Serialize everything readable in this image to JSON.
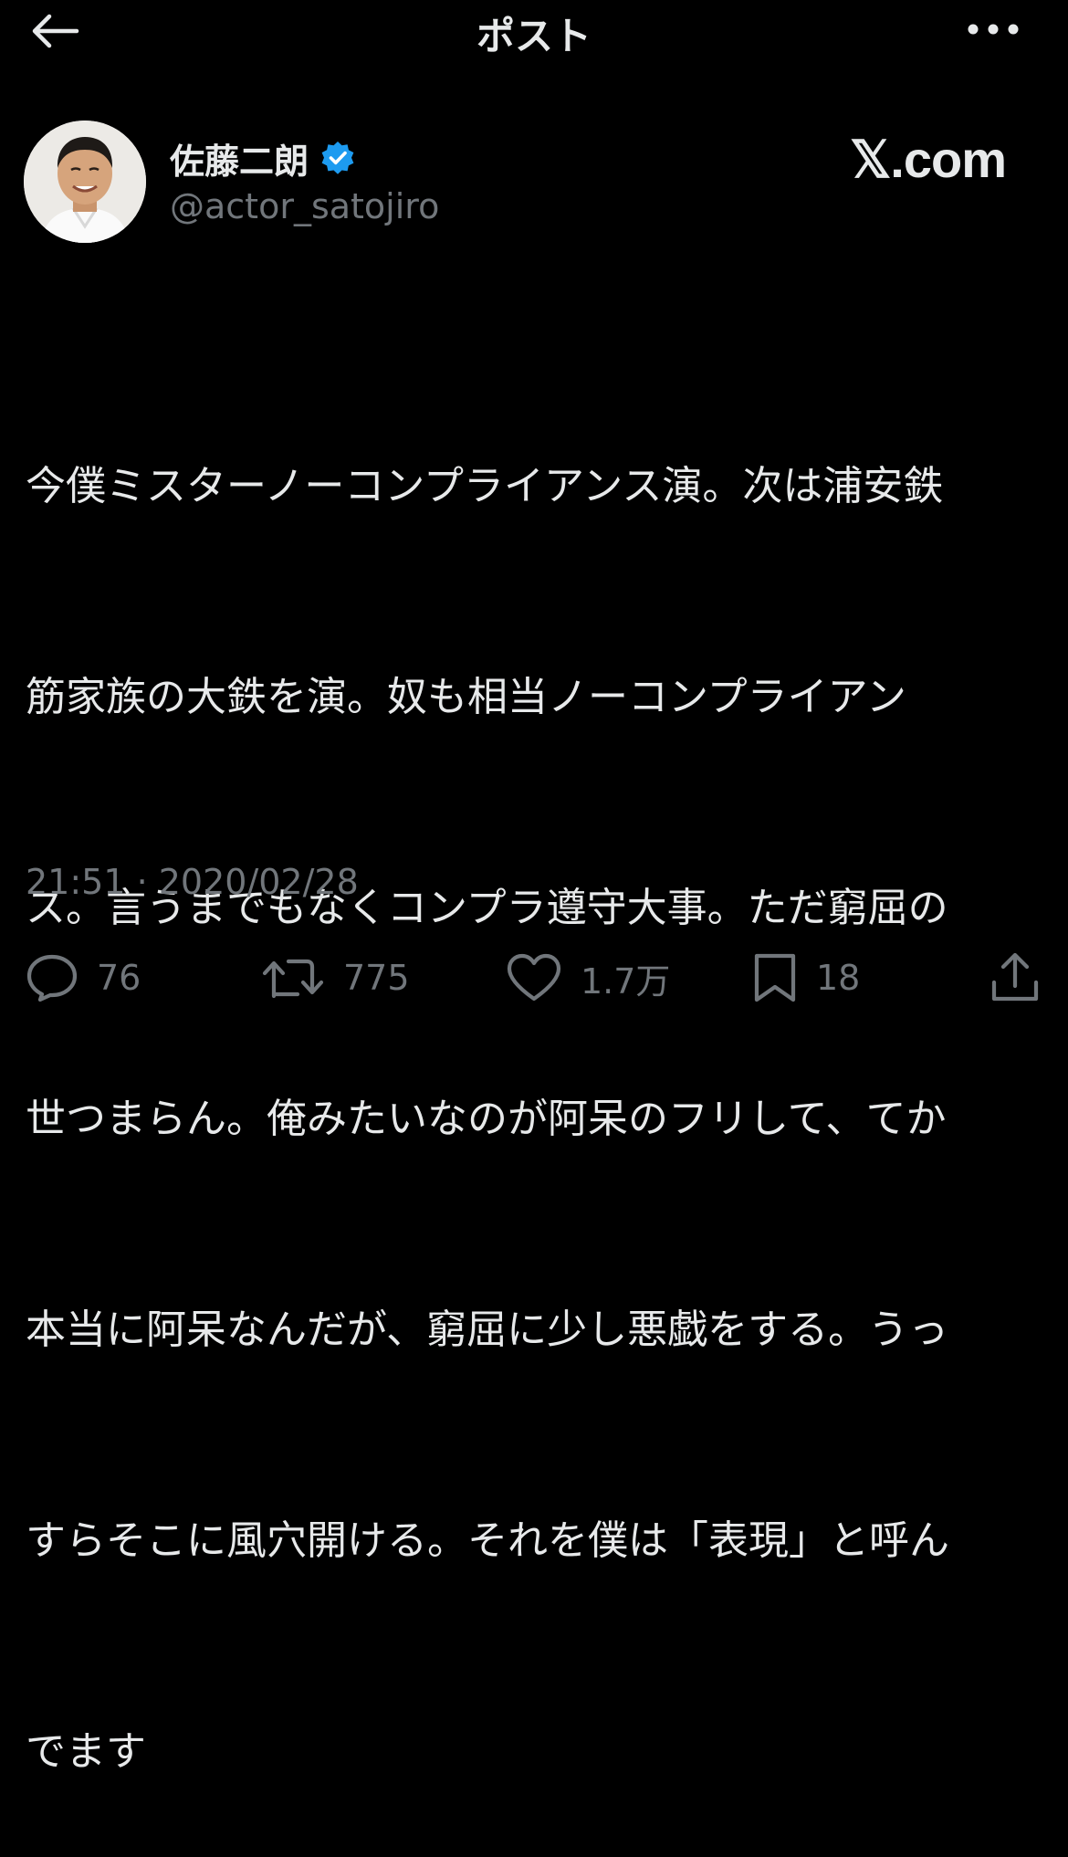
{
  "header": {
    "title": "ポスト",
    "back_icon": "arrow-left-icon",
    "more_icon": "more-horizontal-icon"
  },
  "author": {
    "display_name": "佐藤二朗",
    "handle": "@actor_satojiro",
    "verified": true,
    "verified_color": "#1d9bf0",
    "watermark": "𝕏.com"
  },
  "post": {
    "text": "今僕ミスターノーコンプライアンス演。次は浦安鉄筋家族の大鉄を演。奴も相当ノーコンプライアンス。言うまでもなくコンプラ遵守大事。ただ窮屈の世つまらん。俺みたいなのが阿呆のフリして、てか本当に阿呆なんだが、窮屈に少し悪戯をする。うっすらそこに風穴開ける。それを僕は「表現」と呼んでます",
    "lines": [
      "今僕ミスターノーコンプライアンス演。次は浦安鉄",
      "筋家族の大鉄を演。奴も相当ノーコンプライアン",
      "ス。言うまでもなくコンプラ遵守大事。ただ窮屈の",
      "世つまらん。俺みたいなのが阿呆のフリして、てか",
      "本当に阿呆なんだが、窮屈に少し悪戯をする。うっ",
      "すらそこに風穴開ける。それを僕は「表現」と呼ん",
      "でます"
    ],
    "timestamp": "21:51 · 2020/02/28"
  },
  "actions": {
    "reply_count": "76",
    "repost_count": "775",
    "like_count": "1.7万",
    "bookmark_count": "18"
  },
  "colors": {
    "background": "#000000",
    "text_primary": "#e7e9ea",
    "text_secondary": "#71767b"
  }
}
